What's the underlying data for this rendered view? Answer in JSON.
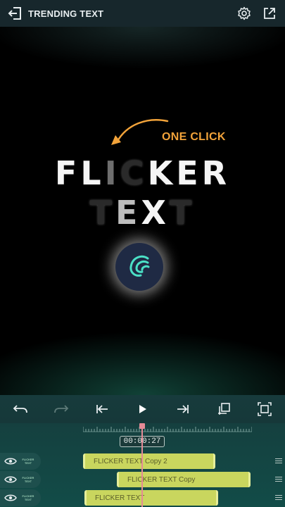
{
  "topbar": {
    "title": "TRENDING TEXT",
    "back_icon": "exit-icon",
    "settings_icon": "gear-icon",
    "share_icon": "share-icon"
  },
  "preview": {
    "annotation": "ONE CLICK",
    "annotation_color": "#f2a33a",
    "line1": [
      {
        "char": "F",
        "tone": "white"
      },
      {
        "char": "L",
        "tone": "white"
      },
      {
        "char": "I",
        "tone": "gray"
      },
      {
        "char": "C",
        "tone": "dark"
      },
      {
        "char": "K",
        "tone": "white"
      },
      {
        "char": "E",
        "tone": "white"
      },
      {
        "char": "R",
        "tone": "white"
      }
    ],
    "line2": [
      {
        "char": "T",
        "tone": "dark"
      },
      {
        "char": "E",
        "tone": "lgray"
      },
      {
        "char": "X",
        "tone": "white"
      },
      {
        "char": "T",
        "tone": "dark"
      }
    ],
    "logo_icon": "alight-motion-logo"
  },
  "controls": {
    "undo_icon": "undo-icon",
    "redo_icon": "redo-icon",
    "skip_start_icon": "skip-to-start-icon",
    "play_icon": "play-icon",
    "skip_end_icon": "skip-to-end-icon",
    "add_layer_icon": "duplicate-layer-icon",
    "fit_icon": "fit-screen-icon"
  },
  "timeline": {
    "timecode": "00:00:27",
    "tracks": [
      {
        "thumb": "FLICKER TEXT",
        "clip": "FLICKER TEXT Copy 2"
      },
      {
        "thumb": "FLICKER TEXT",
        "clip": "FLICKER TEXT Copy"
      },
      {
        "thumb": "FLICKER TEXT",
        "clip": "FLICKER TEXT"
      }
    ]
  }
}
